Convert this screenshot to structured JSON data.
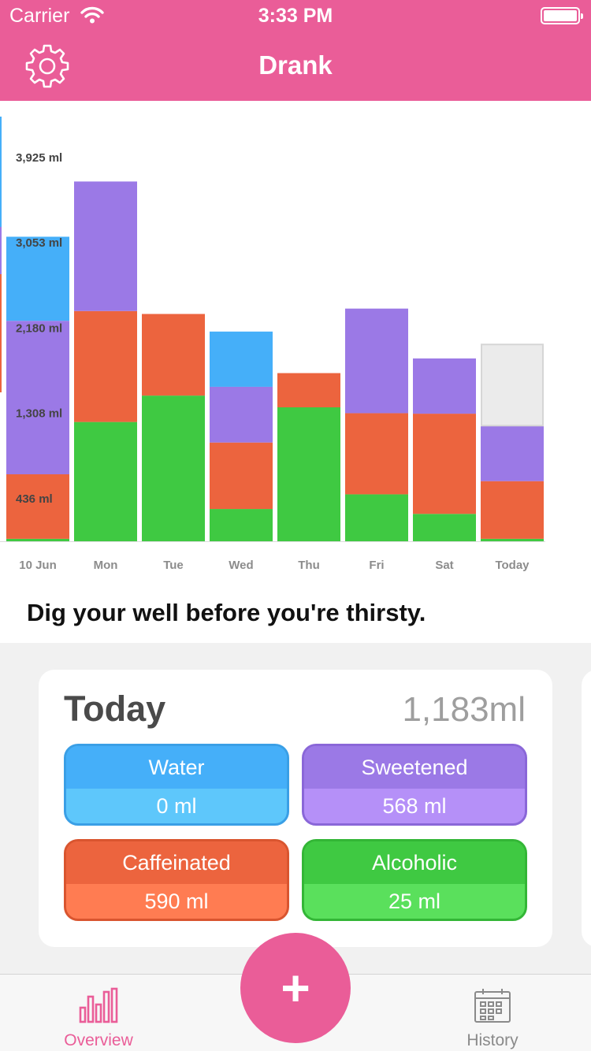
{
  "status_bar": {
    "carrier": "Carrier",
    "time": "3:33 PM"
  },
  "nav": {
    "title": "Drank"
  },
  "colors": {
    "brand": "#ea5d98",
    "water": "#45aff9",
    "sweetened": "#9b79e6",
    "caffeinated": "#ec643e",
    "alcoholic": "#3fc942",
    "remaining": "#ebebeb"
  },
  "chart_data": {
    "type": "bar",
    "stacked": true,
    "unit": "ml",
    "y_tick_labels": [
      "3,925  ml",
      "3,053  ml",
      "2,180  ml",
      "1,308  ml",
      "436  ml"
    ],
    "y_ticks": [
      3925,
      3053,
      2180,
      1308,
      436
    ],
    "ylim": [
      0,
      4360
    ],
    "categories": [
      "10 Jun",
      "Mon",
      "Tue",
      "Wed",
      "Thu",
      "Fri",
      "Sat",
      "Today"
    ],
    "series": [
      {
        "color": "#3fc942",
        "values": [
          25,
          1220,
          1490,
          330,
          1370,
          480,
          280,
          25
        ]
      },
      {
        "color": "#ec643e",
        "values": [
          660,
          1135,
          835,
          680,
          350,
          830,
          1025,
          590
        ]
      },
      {
        "color": "#9b79e6",
        "values": [
          1570,
          1325,
          0,
          570,
          0,
          1070,
          565,
          568
        ]
      },
      {
        "color": "#45aff9",
        "values": [
          860,
          0,
          0,
          565,
          0,
          0,
          0,
          0
        ]
      }
    ],
    "today_remaining": 830,
    "left_edge_partial_bars": true
  },
  "quote": "Dig your well before you're thirsty.",
  "today_card": {
    "title": "Today",
    "total": "1,183ml",
    "tiles": [
      {
        "label": "Water",
        "value": "0 ml",
        "color_top": "#45aff9",
        "color_bottom": "#5ec7fb",
        "border": "#3a9fe6"
      },
      {
        "label": "Sweetened",
        "value": "568 ml",
        "color_top": "#9b79e6",
        "color_bottom": "#b590f8",
        "border": "#8a67d8"
      },
      {
        "label": "Caffeinated",
        "value": "590 ml",
        "color_top": "#ec643e",
        "color_bottom": "#ff7c52",
        "border": "#d9552f"
      },
      {
        "label": "Alcoholic",
        "value": "25 ml",
        "color_top": "#3fc942",
        "color_bottom": "#5ae05c",
        "border": "#33b636"
      }
    ]
  },
  "tabbar": {
    "overview_label": "Overview",
    "history_label": "History",
    "overview_color": "#ea5d98",
    "history_color": "#8a8a8a"
  },
  "fab": {
    "symbol": "+"
  }
}
